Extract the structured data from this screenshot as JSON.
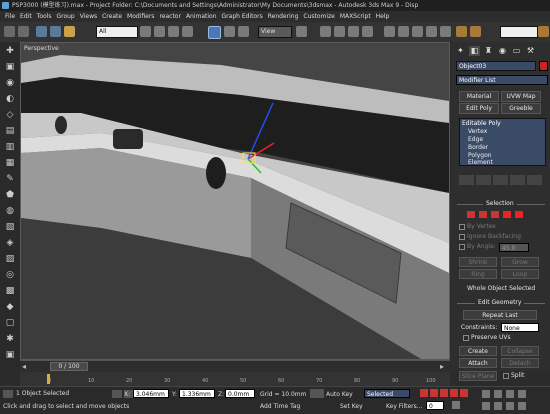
{
  "window": {
    "title": "PSP3000 (模型练习).max - Project Folder: C:\\Documents and Settings\\Administrator\\My Documents\\3dsmax - Autodesk 3ds Max 9 - Disp"
  },
  "menu": [
    "File",
    "Edit",
    "Tools",
    "Group",
    "Views",
    "Create",
    "Modifiers",
    "reactor",
    "Animation",
    "Graph Editors",
    "Rendering",
    "Customize",
    "MAXScript",
    "Help"
  ],
  "toolbar": {
    "selection_filter": "All",
    "coord_system": "View"
  },
  "viewport": {
    "label": "Perspective"
  },
  "command_panel": {
    "object_name": "Object03",
    "object_color": "#cc2222",
    "modifier_list": "Modifier List",
    "buttons": {
      "material": "Material",
      "uvw_map": "UVW Map",
      "edit_poly": "Edit Poly",
      "greeble": "Greeble"
    },
    "stack": {
      "root": "Editable Poly",
      "children": [
        "Vertex",
        "Edge",
        "Border",
        "Polygon",
        "Element"
      ]
    },
    "selection": {
      "title": "Selection",
      "by_vertex": "By Vertex",
      "ignore_backfacing": "Ignore Backfacing",
      "by_angle": "By Angle:",
      "angle_value": "45.0",
      "shrink": "Shrink",
      "grow": "Grow",
      "ring": "Ring",
      "loop": "Loop",
      "status": "Whole Object Selected"
    },
    "edit_geometry": {
      "title": "Edit Geometry",
      "repeat_last": "Repeat Last",
      "constraints_label": "Constraints:",
      "constraints_value": "None",
      "preserve_uvs": "Preserve UVs",
      "create": "Create",
      "collapse": "Collapse",
      "attach": "Attach",
      "detach": "Detach",
      "slice_plane": "Slice Plane",
      "split": "Split"
    }
  },
  "timeline": {
    "frame_display": "0 / 100",
    "ticks": [
      "0",
      "10",
      "20",
      "30",
      "40",
      "50",
      "60",
      "70",
      "80",
      "90",
      "100"
    ]
  },
  "status": {
    "selection_count": "1 Object Selected",
    "prompt": "Click and drag to select and move objects",
    "x_label": "X:",
    "x_value": "3.046mm",
    "y_label": "Y:",
    "y_value": "1.336mm",
    "z_label": "Z:",
    "z_value": "0.0mm",
    "grid": "Grid = 10.0mm",
    "add_time_tag": "Add Time Tag",
    "auto_key": "Auto Key",
    "set_key": "Set Key",
    "key_mode": "Selected",
    "key_filters": "Key Filters...",
    "frame": "0"
  }
}
